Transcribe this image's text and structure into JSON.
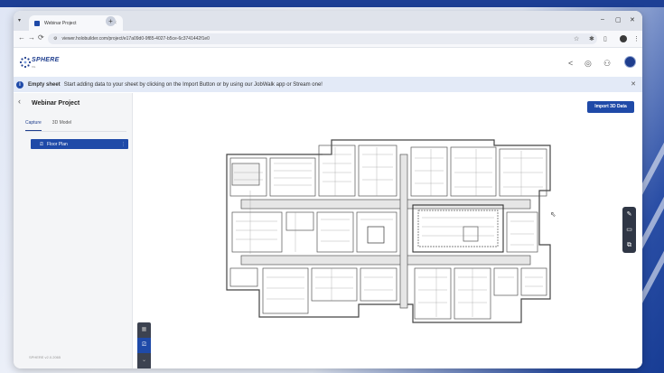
{
  "browser": {
    "tab_title": "Webinar Project",
    "tab_close": "×",
    "new_tab": "+",
    "tab_dropdown": "▾",
    "window_controls": [
      "–",
      "▢",
      "✕"
    ],
    "url": "viewer.holobuilder.com/project/e17a09d0-9f85-4027-b5ce-6c3741442f1e0",
    "nav": {
      "back": "←",
      "forward": "→",
      "reload": "⟳"
    },
    "icons": [
      "bookmark-star-icon",
      "extensions-icon",
      "sidepanel-icon",
      "profile-icon",
      "menu-icon"
    ]
  },
  "app": {
    "brand": "SPHERE",
    "brand_sub": "XG",
    "header_icons": [
      "share-icon",
      "location-settings-icon",
      "users-icon",
      "avatar"
    ]
  },
  "banner": {
    "title": "Empty sheet",
    "message": "Start adding data to your sheet by clicking on the Import Button or by using our JobWalk app or Stream one!",
    "info": "i",
    "close": "✕"
  },
  "sidebar": {
    "back": "‹",
    "project_title": "Webinar Project",
    "tabs": [
      {
        "label": "Capture",
        "active": true
      },
      {
        "label": "3D Model",
        "active": false
      }
    ],
    "floor_item": "Floor Plan",
    "floor_more": "⋮",
    "version": "SPHERE v2.0.2065"
  },
  "canvas": {
    "import_label": "Import 3D Data",
    "right_tools": [
      "pencil-icon",
      "comment-icon",
      "image-annotation-icon"
    ],
    "left_tools": [
      "map-icon",
      "floorplan-icon",
      "chevron-down-icon"
    ]
  },
  "colors": {
    "accent": "#1f4aa8",
    "brand": "#1f3e8e",
    "banner_bg": "#e3eaf7",
    "toolbar_dark": "#2f3645"
  }
}
